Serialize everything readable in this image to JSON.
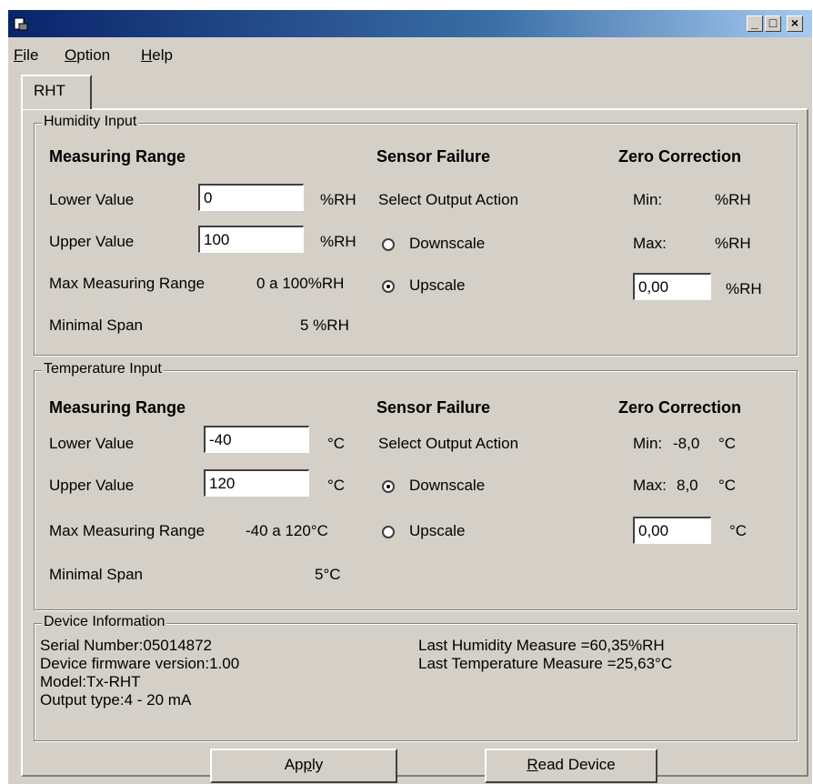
{
  "window": {
    "icon": "app-icon",
    "controls": {
      "minimize": "_",
      "maximize": "□",
      "close": "×"
    }
  },
  "menu": {
    "file": {
      "first": "F",
      "rest": "ile"
    },
    "option": {
      "first": "O",
      "rest": "ption"
    },
    "help": {
      "first": "H",
      "rest": "elp"
    }
  },
  "tab": {
    "label": "RHT"
  },
  "humidity": {
    "legend": "Humidity Input",
    "measuring_range": "Measuring Range",
    "lower_label": "Lower Value",
    "lower_value": "0",
    "lower_unit": "%RH",
    "upper_label": "Upper Value",
    "upper_value": "100",
    "upper_unit": "%RH",
    "max_range_label": "Max Measuring Range",
    "max_range_value": "0 a 100%RH",
    "min_span_label": "Minimal Span",
    "min_span_value": "5 %RH",
    "sensor_failure": "Sensor Failure",
    "select_output": "Select Output Action",
    "downscale": "Downscale",
    "upscale": "Upscale",
    "selected": "upscale",
    "zero_correction": "Zero Correction",
    "min_label": "Min:",
    "min_value": "",
    "min_unit": "%RH",
    "max_label": "Max:",
    "max_value": "",
    "max_unit": "%RH",
    "zero_value": "0,00",
    "zero_unit": "%RH"
  },
  "temperature": {
    "legend": "Temperature Input",
    "measuring_range": "Measuring Range",
    "lower_label": "Lower Value",
    "lower_value": "-40",
    "lower_unit": "°C",
    "upper_label": "Upper Value",
    "upper_value": "120",
    "upper_unit": "°C",
    "max_range_label": "Max Measuring Range",
    "max_range_value": "-40 a 120°C",
    "min_span_label": "Minimal Span",
    "min_span_value": "5°C",
    "sensor_failure": "Sensor Failure",
    "select_output": "Select Output Action",
    "downscale": "Downscale",
    "upscale": "Upscale",
    "selected": "downscale",
    "zero_correction": "Zero Correction",
    "min_label": "Min:",
    "min_value": "-8,0",
    "min_unit": "°C",
    "max_label": "Max:",
    "max_value": "8,0",
    "max_unit": "°C",
    "zero_value": "0,00",
    "zero_unit": "°C"
  },
  "device": {
    "legend": "Device Information",
    "serial": "Serial Number:05014872",
    "firmware": "Device firmware version:1.00",
    "model": "Model:Tx-RHT",
    "output": "Output type:4 - 20 mA",
    "last_humidity": "Last Humidity Measure =60,35%RH",
    "last_temperature": "Last Temperature Measure =25,63°C"
  },
  "buttons": {
    "apply": {
      "pre": "Ap",
      "u": "p",
      "post": "ly"
    },
    "read": {
      "pre": "",
      "u": "R",
      "post": "ead Device"
    }
  }
}
